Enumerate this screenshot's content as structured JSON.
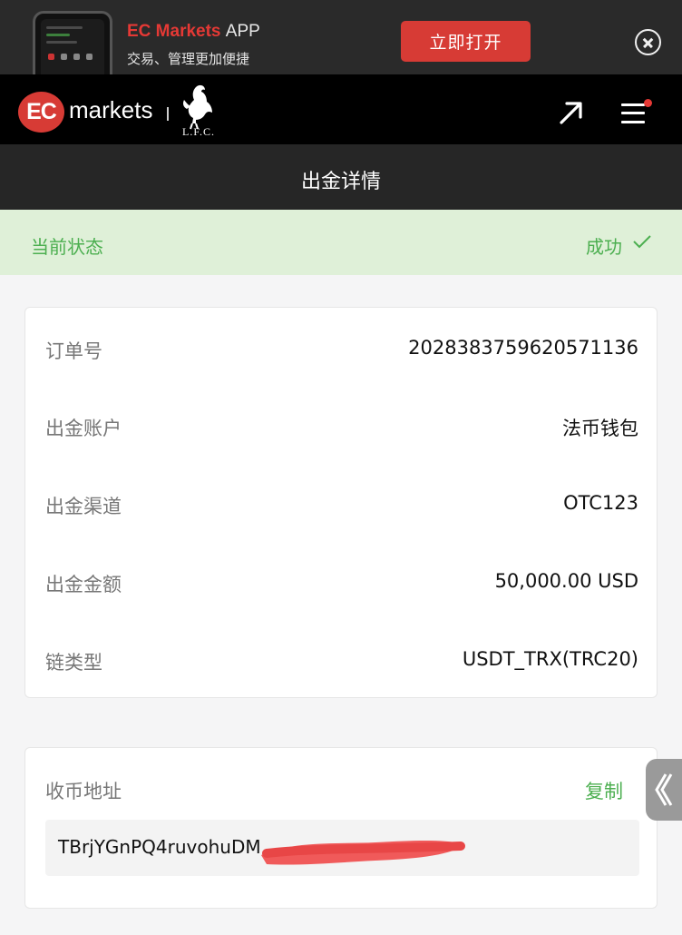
{
  "banner": {
    "brand": "EC Markets",
    "brand_suffix": "APP",
    "tagline": "交易、管理更加便捷",
    "open_button": "立即打开"
  },
  "header": {
    "logo_mark": "EC",
    "logo_text": "markets",
    "partner_text": "L.F.C.",
    "icons": [
      "external-arrow-icon",
      "menu-icon"
    ]
  },
  "page": {
    "title": "出金详情"
  },
  "status": {
    "label": "当前状态",
    "value": "成功",
    "icon": "check-icon"
  },
  "details": {
    "rows": [
      {
        "label": "订单号",
        "value": "2028383759620571136"
      },
      {
        "label": "出金账户",
        "value": "法币钱包"
      },
      {
        "label": "出金渠道",
        "value": "OTC123"
      },
      {
        "label": "出金金额",
        "value": "50,000.00 USD"
      },
      {
        "label": "链类型",
        "value": "USDT_TRX(TRC20)"
      }
    ]
  },
  "address": {
    "label": "收币地址",
    "copy": "复制",
    "value_visible": "TBrjYGnPQ4ruvohuDM"
  },
  "colors": {
    "accent_red": "#d73b35",
    "success_green": "#4caf50",
    "status_bg": "#dff0d8"
  }
}
